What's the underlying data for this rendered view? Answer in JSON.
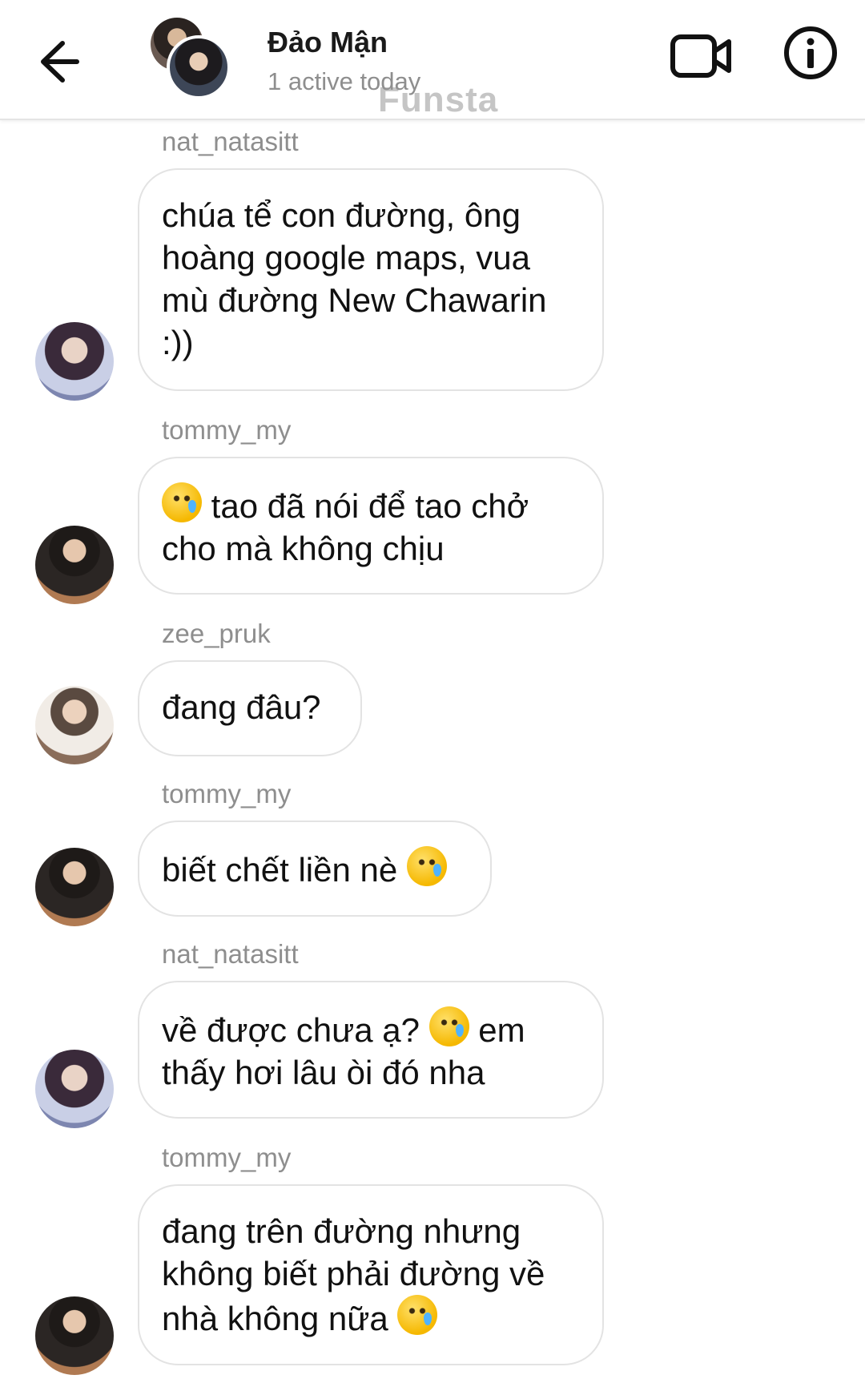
{
  "header": {
    "title": "Đảo Mận",
    "status": "1 active today",
    "watermark": "Funsta",
    "icons": [
      "back-arrow-icon",
      "group-avatar",
      "video-call-icon",
      "info-icon"
    ]
  },
  "messages": [
    {
      "sender": "nat_natasitt",
      "text": "chúa tể con đường, ông hoàng google maps, vua mù đường New Chawarin :))",
      "avatar": "nat"
    },
    {
      "sender": "tommy_my",
      "text_before": "",
      "emoji": "😢",
      "text": "tao đã nói để tao chở cho mà không chịu",
      "avatar": "tommy"
    },
    {
      "sender": "zee_pruk",
      "text": "đang đâu?",
      "avatar": "zee"
    },
    {
      "sender": "tommy_my",
      "text": "biết chết liền nè",
      "emoji": "😢",
      "avatar": "tommy"
    },
    {
      "sender": "nat_natasitt",
      "text_a": "về được chưa ạ?",
      "emoji": "😢",
      "text_b": "em thấy hơi lâu òi đó nha",
      "avatar": "nat"
    },
    {
      "sender": "tommy_my",
      "text": "đang trên đường nhưng không biết phải đường về nhà không nữa",
      "emoji": "😢",
      "avatar": "tommy"
    }
  ]
}
